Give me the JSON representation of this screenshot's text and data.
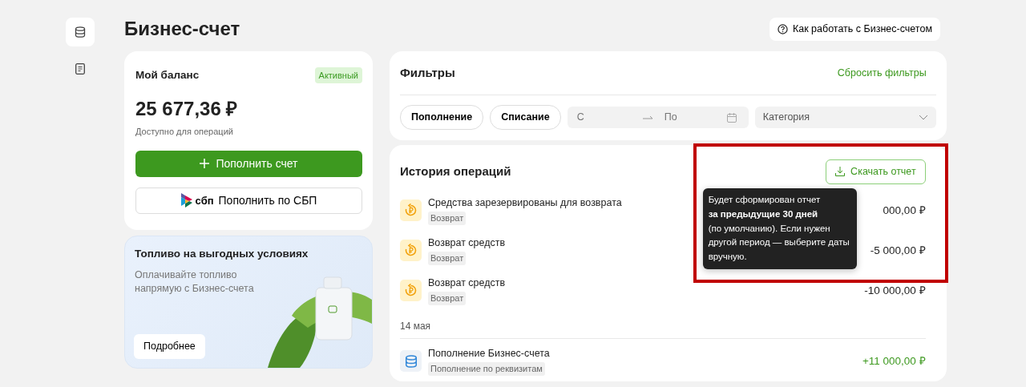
{
  "sidebar": {
    "items": [
      {
        "kind": "coins",
        "selected": true
      },
      {
        "kind": "document",
        "selected": false
      }
    ]
  },
  "header": {
    "title": "Бизнес-счет",
    "help_button": "Как работать с Бизнес-счетом"
  },
  "balance": {
    "title": "Мой баланс",
    "status": "Активный",
    "amount": "25 677,36 ₽",
    "caption": "Доступно для операций",
    "primary_button": "Пополнить счет",
    "sbp_logo": "сбп",
    "sbp_button": "Пополнить по СБП"
  },
  "promo": {
    "title": "Топливо на выгодных условиях",
    "text": "Оплачивайте топливо напрямую с Бизнес-счета",
    "button": "Подробнее"
  },
  "filters": {
    "title": "Фильтры",
    "reset": "Сбросить фильтры",
    "chips": [
      {
        "label": "Пополнение",
        "selected": false
      },
      {
        "label": "Списание",
        "selected": false
      }
    ],
    "date_from": {
      "placeholder": "С"
    },
    "date_to": {
      "placeholder": "По"
    },
    "category": {
      "placeholder": "Категория"
    }
  },
  "history": {
    "title": "История операций",
    "download_button": "Скачать отчет",
    "tooltip": "Будет сформирован отчет\n**за предыдущие 30 дней**\n(по умолчанию). Если нужен\nдругой период — выберите даты\nвручную.",
    "groups": [
      {
        "items": [
          {
            "kind": "refund",
            "title": "Средства зарезервированы для возврата",
            "tag": "Возврат",
            "amount": "000,00 ₽"
          },
          {
            "kind": "refund",
            "title": "Возврат средств",
            "tag": "Возврат",
            "amount": "-5 000,00 ₽"
          },
          {
            "kind": "refund",
            "title": "Возврат средств",
            "tag": "Возврат",
            "amount": "-10 000,00 ₽"
          }
        ]
      },
      {
        "date": "14 мая",
        "items": [
          {
            "kind": "topup",
            "title": "Пополнение Бизнес-счета",
            "tag": "Пополнение по реквизитам",
            "amount": "+11 000,00 ₽"
          }
        ]
      }
    ]
  }
}
